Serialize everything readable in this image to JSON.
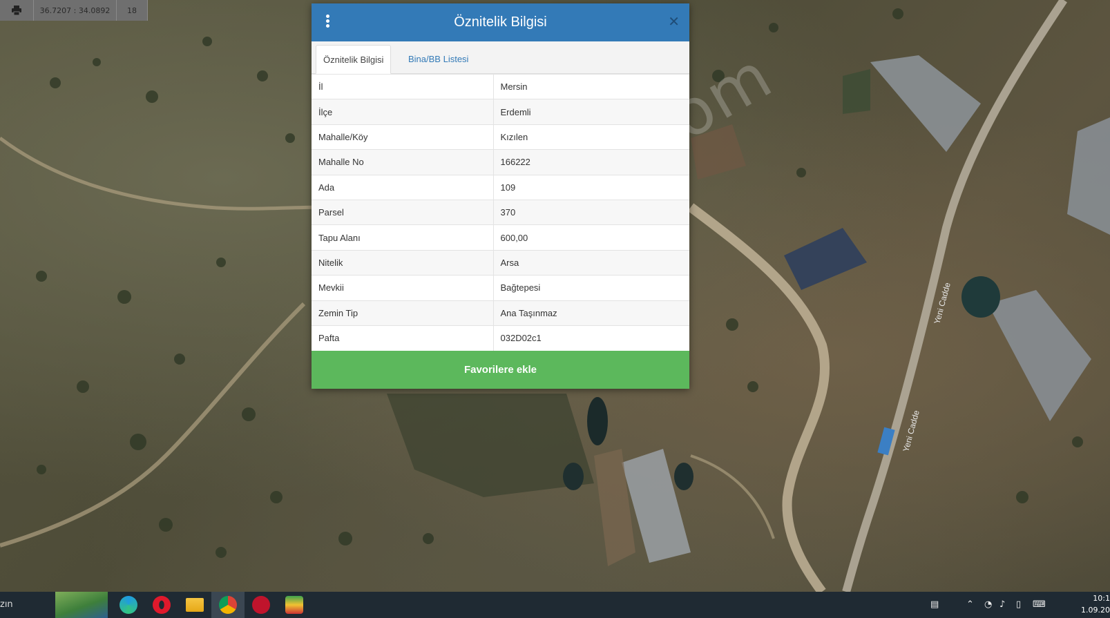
{
  "map_toolbar": {
    "coords": "36.7207 : 34.0892",
    "zoom": "18"
  },
  "watermark": "emlakjet.com",
  "modal": {
    "title": "Öznitelik Bilgisi",
    "tabs": [
      {
        "label": "Öznitelik Bilgisi",
        "active": true
      },
      {
        "label": "Bina/BB Listesi",
        "active": false
      }
    ],
    "rows": [
      {
        "key": "İl",
        "value": "Mersin"
      },
      {
        "key": "İlçe",
        "value": "Erdemli"
      },
      {
        "key": "Mahalle/Köy",
        "value": "Kızılen"
      },
      {
        "key": "Mahalle No",
        "value": "166222"
      },
      {
        "key": "Ada",
        "value": "109"
      },
      {
        "key": "Parsel",
        "value": "370"
      },
      {
        "key": "Tapu Alanı",
        "value": "600,00"
      },
      {
        "key": "Nitelik",
        "value": "Arsa"
      },
      {
        "key": "Mevkii",
        "value": "Bağtepesi"
      },
      {
        "key": "Zemin Tip",
        "value": "Ana Taşınmaz"
      },
      {
        "key": "Pafta",
        "value": "032D02c1"
      }
    ],
    "favorite_label": "Favorilere ekle"
  },
  "map_labels": {
    "road_1": "Yeni Cadde",
    "road_2": "Yeni Cadde"
  },
  "taskbar": {
    "search_fragment": "zın",
    "clock_time": "10:1",
    "clock_date": "1.09.20"
  },
  "colors": {
    "header_blue": "#337ab7",
    "favorite_green": "#5cb85c",
    "taskbar": "#1f2a33"
  }
}
